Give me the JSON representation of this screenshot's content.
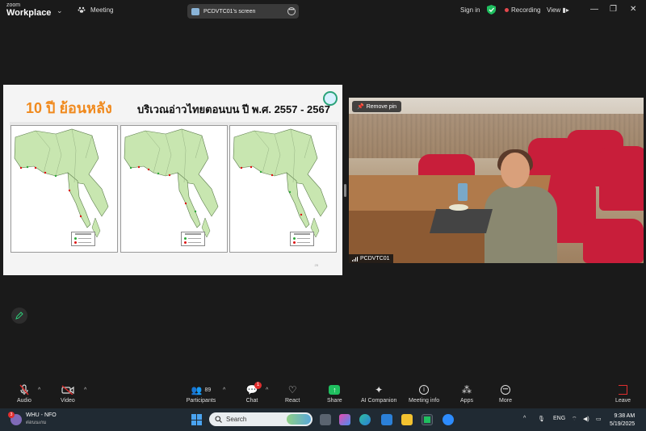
{
  "titlebar": {
    "brand_top": "zoom",
    "brand_bottom": "Workplace",
    "meeting": "Meeting",
    "screen_tab": "PCDVTC01's screen",
    "sign_in": "Sign in",
    "recording": "Recording",
    "view": "View"
  },
  "slide": {
    "title_left": "10 ปี ย้อนหลัง",
    "title_main": "บริเวณอ่าวไทยตอนบน ปี พ.ศ. 2557 - 2567",
    "page_number": "25"
  },
  "video": {
    "remove_pin": "Remove pin",
    "participant_name": "PCDVTC01"
  },
  "toolbar": {
    "audio": "Audio",
    "video": "Video",
    "participants": "Participants",
    "participants_count": "89",
    "chat": "Chat",
    "chat_badge": "1",
    "react": "React",
    "share": "Share",
    "ai_companion": "AI Companion",
    "meeting_info": "Meeting info",
    "apps": "Apps",
    "more": "More",
    "leave": "Leave"
  },
  "taskbar": {
    "app_title": "WHU - NFO",
    "app_subtitle": "ต่อนนเกม",
    "app_badge": "3",
    "search_placeholder": "Search",
    "language": "ENG",
    "time": "9:38 AM",
    "date": "5/19/2025"
  },
  "colors": {
    "accent_orange": "#f08a1e",
    "recording_red": "#e5484d",
    "share_green": "#1fbf5f",
    "chair_red": "#c81e3a"
  }
}
